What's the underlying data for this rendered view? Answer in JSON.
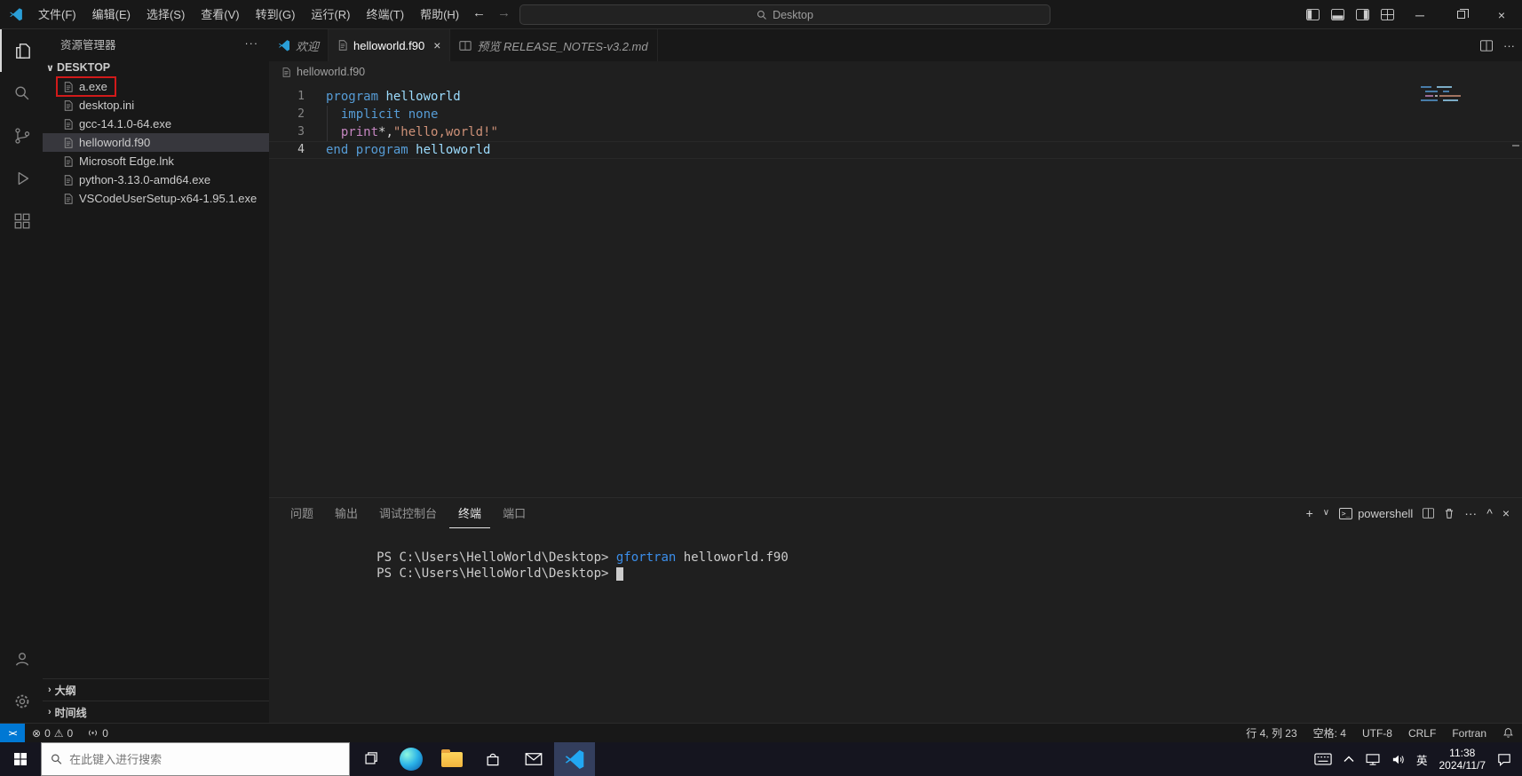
{
  "colors": {
    "keyword": "#569cd6",
    "ident": "#9cdcfe",
    "func": "#c586c0",
    "string": "#ce9178",
    "plain": "#d4d4d4",
    "term_plain": "#cccccc",
    "command": "#3b8eea",
    "accent": "#0078d4",
    "annotation": "#d11a1a"
  },
  "icons": {
    "back_arrow": "←",
    "forward_arrow": "→",
    "more_horizontal": "···",
    "close": "×",
    "minimize": "─",
    "chevron_down": "∨",
    "chevron_right": "›",
    "chevron_up": "^",
    "plus": "+",
    "error": "⊗",
    "warning": "⚠"
  },
  "title_bar": {
    "menus": [
      "文件(F)",
      "编辑(E)",
      "选择(S)",
      "查看(V)",
      "转到(G)",
      "运行(R)",
      "终端(T)",
      "帮助(H)"
    ],
    "search_text": "Desktop"
  },
  "sidebar": {
    "title": "资源管理器",
    "root": "DESKTOP",
    "files": [
      {
        "name": "a.exe",
        "annotated": true
      },
      {
        "name": "desktop.ini"
      },
      {
        "name": "gcc-14.1.0-64.exe"
      },
      {
        "name": "helloworld.f90",
        "selected": true
      },
      {
        "name": "Microsoft Edge.lnk"
      },
      {
        "name": "python-3.13.0-amd64.exe"
      },
      {
        "name": "VSCodeUserSetup-x64-1.95.1.exe"
      }
    ],
    "sections": [
      "大纲",
      "时间线"
    ]
  },
  "editor_tabs": [
    {
      "label": "欢迎",
      "icon": "vscode",
      "preview": true
    },
    {
      "label": "helloworld.f90",
      "icon": "file",
      "active": true
    },
    {
      "label": "预览 RELEASE_NOTES-v3.2.md",
      "icon": "preview",
      "preview": true
    }
  ],
  "editor": {
    "breadcrumb": "helloworld.f90",
    "lines": [
      {
        "num": "1",
        "tokens": [
          {
            "t": "program",
            "c": "keyword"
          },
          {
            "t": " ",
            "c": "plain"
          },
          {
            "t": "helloworld",
            "c": "ident"
          }
        ]
      },
      {
        "num": "2",
        "tokens": [
          {
            "t": "  ",
            "c": "plain"
          },
          {
            "t": "implicit",
            "c": "keyword"
          },
          {
            "t": " ",
            "c": "plain"
          },
          {
            "t": "none",
            "c": "keyword"
          }
        ]
      },
      {
        "num": "3",
        "tokens": [
          {
            "t": "  ",
            "c": "plain"
          },
          {
            "t": "print",
            "c": "func"
          },
          {
            "t": "*,",
            "c": "plain"
          },
          {
            "t": "\"hello,world!\"",
            "c": "string"
          }
        ]
      },
      {
        "num": "4",
        "current": true,
        "tokens": [
          {
            "t": "end program",
            "c": "keyword"
          },
          {
            "t": " ",
            "c": "plain"
          },
          {
            "t": "helloworld",
            "c": "ident"
          }
        ]
      }
    ]
  },
  "panel": {
    "tabs": [
      {
        "label": "问题"
      },
      {
        "label": "输出"
      },
      {
        "label": "调试控制台"
      },
      {
        "label": "终端",
        "active": true
      },
      {
        "label": "端口"
      }
    ],
    "shell_label": "powershell",
    "terminal_lines": [
      {
        "tokens": [
          {
            "t": "PS C:\\Users\\HelloWorld\\Desktop> ",
            "c": "term_plain"
          },
          {
            "t": "gfortran",
            "c": "command"
          },
          {
            "t": " helloworld.f90",
            "c": "term_plain"
          }
        ]
      },
      {
        "tokens": [
          {
            "t": "PS C:\\Users\\HelloWorld\\Desktop> ",
            "c": "term_plain"
          },
          {
            "t": " ",
            "c": "cursor"
          }
        ]
      }
    ]
  },
  "status_bar": {
    "remote_glyph": "><",
    "errors": "0",
    "warnings": "0",
    "ports": "0",
    "right_items": [
      "行 4, 列 23",
      "空格: 4",
      "UTF-8",
      "CRLF",
      "Fortran"
    ]
  },
  "taskbar": {
    "search_placeholder": "在此键入进行搜索",
    "language": "英",
    "time": "11:38",
    "date": "2024/11/7"
  }
}
